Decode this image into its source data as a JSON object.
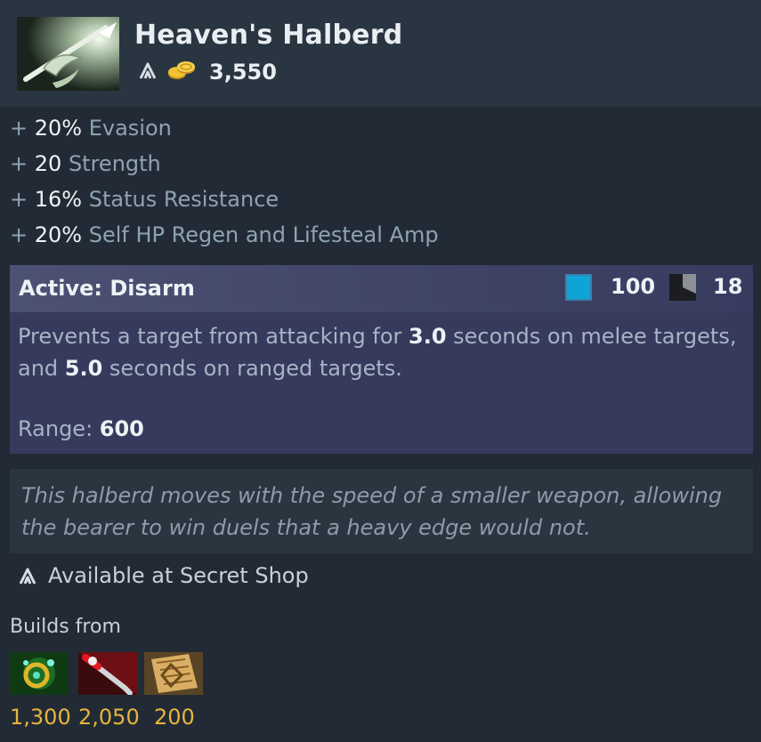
{
  "item": {
    "name": "Heaven's Halberd",
    "icon": "heavens-halberd-icon",
    "cost": "3,550",
    "cost_icons": [
      "secret-shop-icon",
      "gold-coins-icon"
    ]
  },
  "stats": [
    {
      "plus": "+",
      "value": "20%",
      "label": "Evasion"
    },
    {
      "plus": "+",
      "value": "20",
      "label": "Strength"
    },
    {
      "plus": "+",
      "value": "16%",
      "label": "Status Resistance"
    },
    {
      "plus": "+",
      "value": "20%",
      "label": "Self HP Regen and Lifesteal Amp"
    }
  ],
  "active": {
    "title": "Active: Disarm",
    "mana_cost": "100",
    "cooldown": "18",
    "desc_1": "Prevents a target from attacking for ",
    "melee_duration": "3.0",
    "desc_2": " seconds on melee targets, and ",
    "ranged_duration": "5.0",
    "desc_3": " seconds on ranged targets.",
    "range_label": "Range: ",
    "range_value": "600"
  },
  "lore": "This halberd moves with the speed of a smaller weapon, allowing the bearer to win duels that a heavy edge would not.",
  "shop": {
    "icon": "secret-shop-icon",
    "text": "Available at Secret Shop"
  },
  "builds": {
    "label": "Builds from",
    "components": [
      {
        "icon": "talisman-of-evasion-icon",
        "price": "1,300"
      },
      {
        "icon": "sange-icon",
        "price": "2,050"
      },
      {
        "icon": "recipe-scroll-icon",
        "price": "200"
      }
    ]
  },
  "colors": {
    "background": "#222b35",
    "active_panel": "#363a5c",
    "mana": "#0fa3d8",
    "gold_text": "#e8b43c"
  }
}
